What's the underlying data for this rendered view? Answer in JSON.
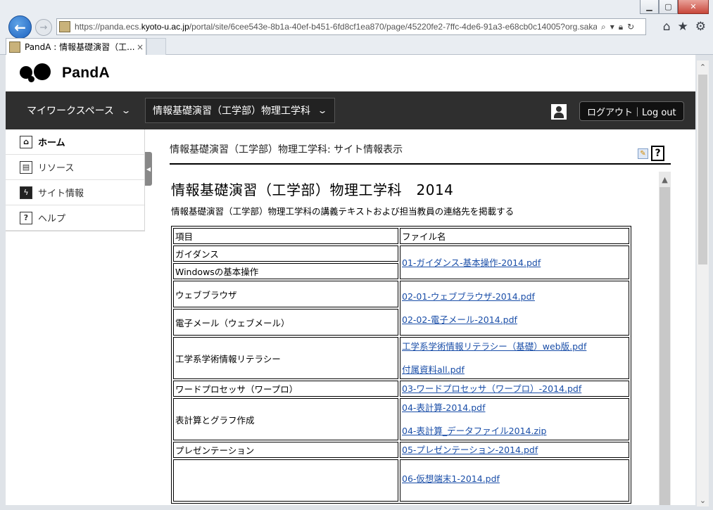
{
  "browser": {
    "url_prefix": "https://panda.ecs.",
    "url_domain": "kyoto-u.ac.jp",
    "url_path": "/portal/site/6cee543e-8b1a-40ef-b451-6fd8cf1ea870/page/45220fe2-7ffc-4de6-91a3-e68cb0c14005?org.sakaip",
    "tab_title": "PandA : 情報基礎演習（工...",
    "tab_close": "×",
    "icons": [
      "back-arrow-icon",
      "forward-arrow-icon",
      "search-icon",
      "refresh-icon",
      "home-icon",
      "star-icon",
      "gear-icon"
    ]
  },
  "header": {
    "logo_text": "PandA"
  },
  "nav": {
    "workspace": "マイワークスペース",
    "site": "情報基礎演習（工学部）物理工学科",
    "logout": "ログアウト｜Log out"
  },
  "sidebar": {
    "items": [
      {
        "label": "ホーム",
        "icon": "home-icon"
      },
      {
        "label": "リソース",
        "icon": "resources-icon"
      },
      {
        "label": "サイト情報",
        "icon": "site-info-icon"
      },
      {
        "label": "ヘルプ",
        "icon": "help-icon"
      }
    ]
  },
  "tool": {
    "title": "情報基礎演習（工学部）物理工学科: サイト情報表示"
  },
  "site": {
    "title": "情報基礎演習（工学部）物理工学科　2014",
    "description": "情報基礎演習（工学部）物理工学科の講義テキストおよび担当教員の連絡先を掲載する"
  },
  "table": {
    "headers": [
      "項目",
      "ファイル名"
    ],
    "rows": {
      "guidance": "ガイダンス",
      "windows": "Windowsの基本操作",
      "guidance_link": "01-ガイダンス-基本操作-2014.pdf",
      "browser": "ウェブブラウザ",
      "email": "電子メール（ウェブメール）",
      "browser_link": "02-01-ウェブブラウザ-2014.pdf",
      "email_link": "02-02-電子メール-2014.pdf",
      "literacy": "工学系学術情報リテラシー",
      "literacy_link1": "工学系学術情報リテラシー（基礎）web版.pdf",
      "literacy_link2": "付属資料all.pdf",
      "wordproc": "ワードプロセッサ（ワープロ）",
      "wordproc_link": "03-ワードプロセッサ（ワープロ）-2014.pdf",
      "spreadsheet": "表計算とグラフ作成",
      "spreadsheet_link1": "04-表計算-2014.pdf",
      "spreadsheet_link2": "04-表計算_データファイル2014.zip",
      "presentation": "プレゼンテーション",
      "presentation_link": "05-プレゼンテーション-2014.pdf",
      "vm_link": "06-仮想端末1-2014.pdf"
    }
  }
}
